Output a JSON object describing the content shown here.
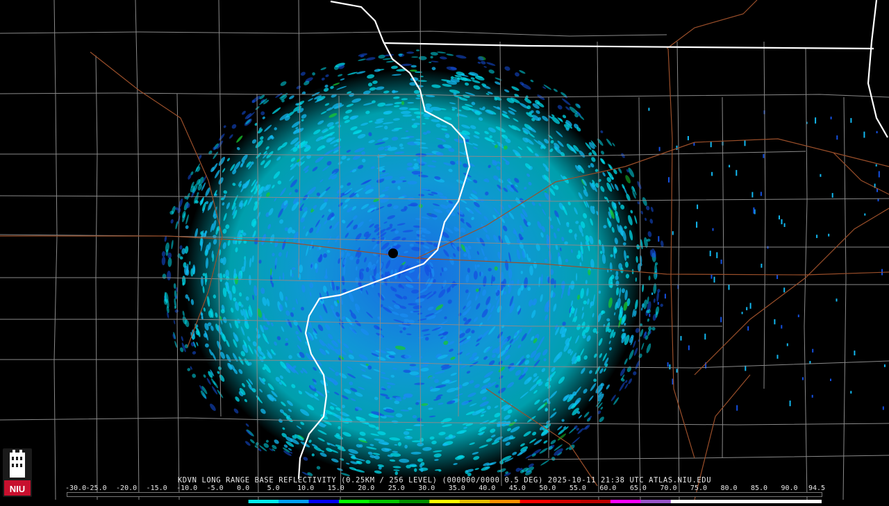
{
  "caption": "KDVN LONG RANGE BASE REFLECTIVITY (0.25KM / 256 LEVEL) (000000/0000 0.5 DEG) 2025-10-11 21:38 UTC  ATLAS.NIU.EDU",
  "logo": {
    "text": "NIU",
    "color_bg": "#c8102e",
    "color_fg": "#ffffff",
    "icon": "university-tower-icon"
  },
  "legend": {
    "labels": [
      "-30.0",
      "-25.0",
      "-20.0",
      "-15.0",
      "-10.0",
      "-5.0",
      "0.0",
      "5.0",
      "10.0",
      "15.0",
      "20.0",
      "25.0",
      "30.0",
      "35.0",
      "40.0",
      "45.0",
      "50.0",
      "55.0",
      "60.0",
      "65.0",
      "70.0",
      "75.0",
      "80.0",
      "85.0",
      "90.0",
      "94.5"
    ],
    "colors": [
      "#000000",
      "#000000",
      "#000000",
      "#000000",
      "#000000",
      "#000000",
      "#00ecec",
      "#01a0f6",
      "#0000f6",
      "#00ff00",
      "#00c800",
      "#009000",
      "#ffff00",
      "#e7c000",
      "#ff9000",
      "#ff0000",
      "#d60000",
      "#c00000",
      "#ff00ff",
      "#9955c9",
      "#ffffff",
      "#ffffff",
      "#ffffff",
      "#ffffff",
      "#ffffff"
    ]
  },
  "map": {
    "background": "#000000",
    "county_line_color": "#8a8a8a",
    "state_line_color": "#ffffff",
    "highway_color": "#a0522d",
    "echo_colors": [
      "#00d8e8",
      "#12b8f0",
      "#1a8cf0",
      "#1450e0",
      "#0a28c0",
      "#18c830"
    ],
    "radar_site": "KDVN"
  }
}
